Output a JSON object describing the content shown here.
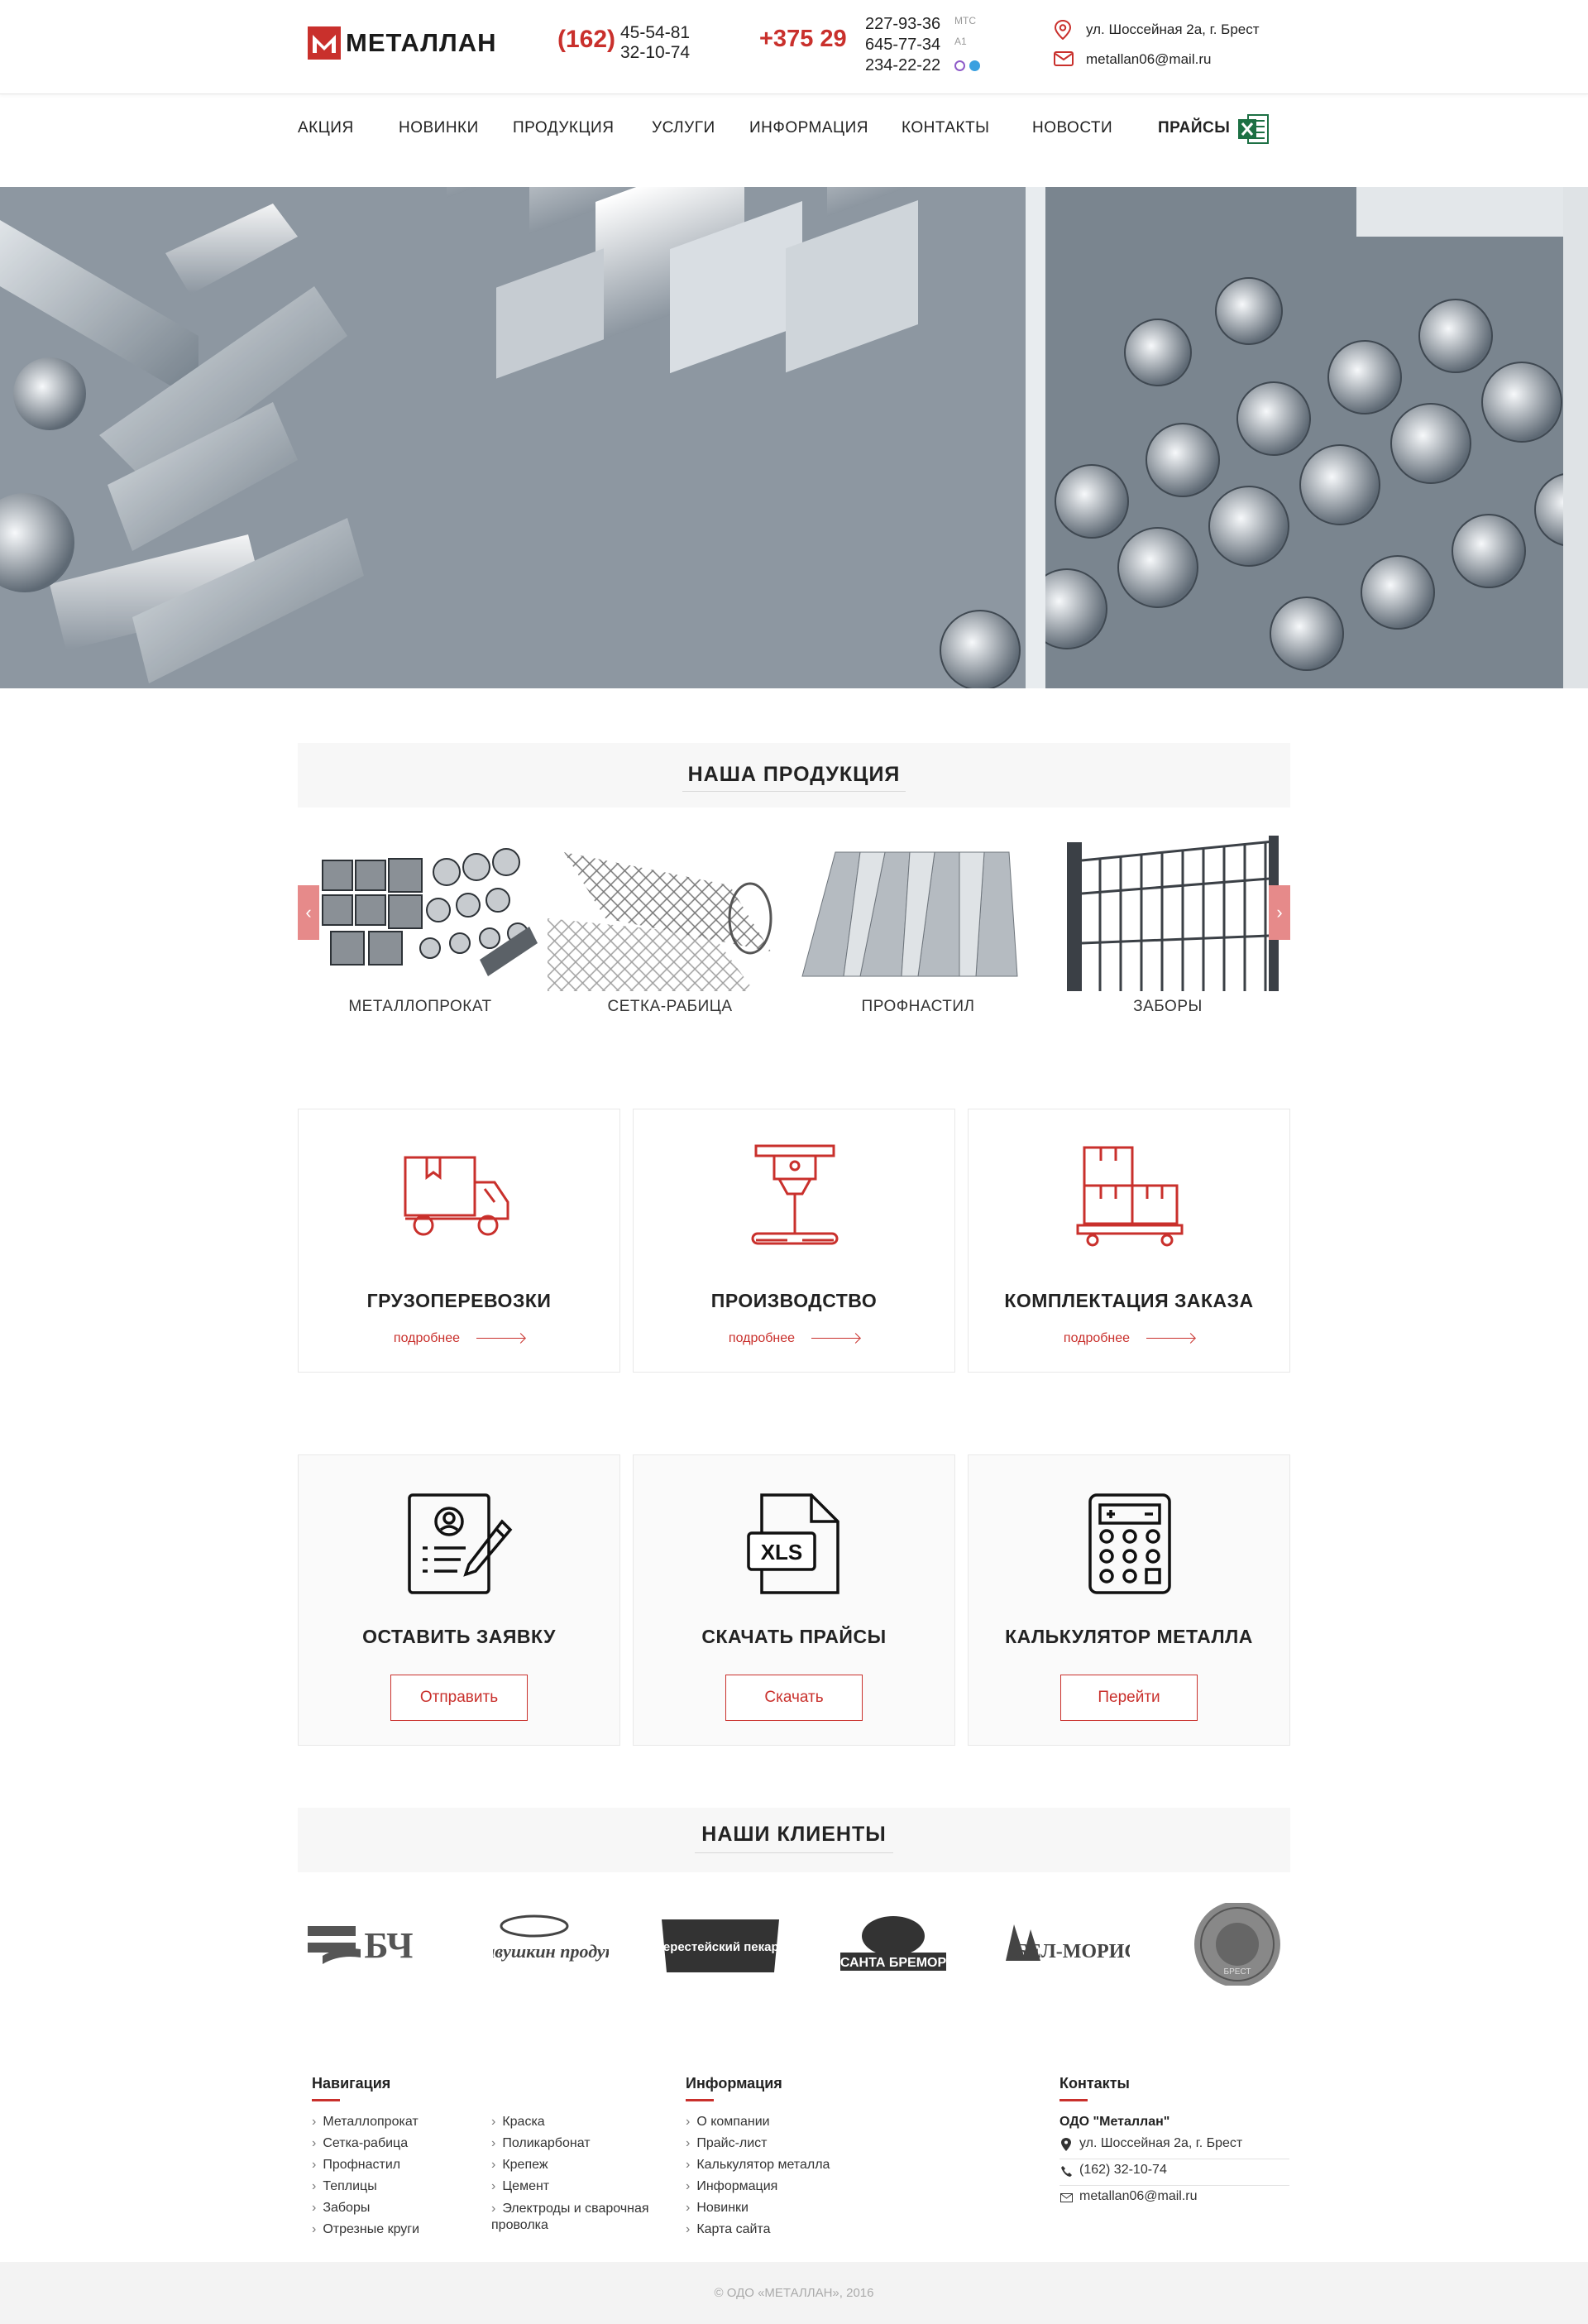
{
  "header": {
    "logo_text": "МЕТАЛЛАН",
    "city_code": "(162)",
    "city_phones": [
      "45-54-81",
      "32-10-74"
    ],
    "mobile_code": "+375 29",
    "mobile_phones": [
      "227-93-36",
      "645-77-34",
      "234-22-22"
    ],
    "operators": [
      "МТС",
      "A1"
    ],
    "address": "ул. Шоссейная 2а, г. Брест",
    "email": "metallan06@mail.ru",
    "accent_color": "#c9302c"
  },
  "nav": {
    "items": [
      "Акция",
      "Новинки",
      "Продукция",
      "Услуги",
      "Информация",
      "Контакты",
      "Новости"
    ],
    "prices_label": "ПРАЙСЫ"
  },
  "products": {
    "title": "НАША ПРОДУКЦИЯ",
    "items": [
      "МЕТАЛЛОПРОКАТ",
      "СЕТКА-РАБИЦА",
      "ПРОФНАСТИЛ",
      "ЗАБОРЫ"
    ],
    "prev": "‹",
    "next": "›"
  },
  "services": [
    {
      "title": "ГРУЗОПЕРЕВОЗКИ",
      "more": "подробнее",
      "icon": "truck-icon"
    },
    {
      "title": "ПРОИЗВОДСТВО",
      "more": "подробнее",
      "icon": "laser-cutter-icon"
    },
    {
      "title": "КОМПЛЕКТАЦИЯ ЗАКАЗА",
      "more": "подробнее",
      "icon": "boxes-cart-icon"
    }
  ],
  "actions": [
    {
      "title": "ОСТАВИТЬ ЗАЯВКУ",
      "button": "Отправить",
      "icon": "form-pen-icon"
    },
    {
      "title": "СКАЧАТЬ ПРАЙСЫ",
      "button": "Скачать",
      "icon": "xls-file-icon",
      "icon_text": "XLS"
    },
    {
      "title": "КАЛЬКУЛЯТОР МЕТАЛЛА",
      "button": "Перейти",
      "icon": "calculator-icon"
    }
  ],
  "clients": {
    "title": "НАШИ КЛИЕНТЫ",
    "logos": [
      {
        "text": "БЧ"
      },
      {
        "text": "Савушкин продукт"
      },
      {
        "text": "Берестейский пекарь"
      },
      {
        "text": "САНТА БРЕМОР"
      },
      {
        "text": "БЕЛ-МОРИС"
      },
      {
        "text": "БРЕСТ"
      }
    ]
  },
  "footer": {
    "nav_title": "Навигация",
    "nav_col1": [
      "Металлопрокат",
      "Сетка-рабица",
      "Профнастил",
      "Теплицы",
      "Заборы",
      "Отрезные круги"
    ],
    "nav_col2": [
      "Краска",
      "Поликарбонат",
      "Крепеж",
      "Цемент",
      "Электроды и сварочная проволка"
    ],
    "info_title": "Информация",
    "info_links": [
      "О компании",
      "Прайс-лист",
      "Калькулятор металла",
      "Информация",
      "Новинки",
      "Карта сайта"
    ],
    "contacts_title": "Контакты",
    "company": "ОДО \"Металлан\"",
    "address": "ул. Шоссейная 2а, г. Брест",
    "phone": "(162) 32-10-74",
    "email": "metallan06@mail.ru",
    "copyright": "© ОДО «МЕТАЛЛАН», 2016"
  }
}
